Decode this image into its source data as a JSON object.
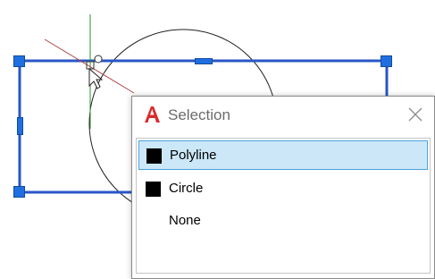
{
  "dialog": {
    "title": "Selection",
    "items": [
      {
        "label": "Polyline",
        "swatch": true,
        "selected": true
      },
      {
        "label": "Circle",
        "swatch": true,
        "selected": false
      },
      {
        "label": "None",
        "swatch": false,
        "selected": false
      }
    ]
  },
  "colors": {
    "grip": "#1f6fe0",
    "polyline": "#2a56c6",
    "selection_highlight": "#cce8f8",
    "selection_border": "#4aa3df",
    "logo_red": "#d82c2c"
  },
  "icons": {
    "app_logo": "autocad-logo-icon",
    "close": "close-icon",
    "cursor": "arrow-cursor-icon"
  }
}
